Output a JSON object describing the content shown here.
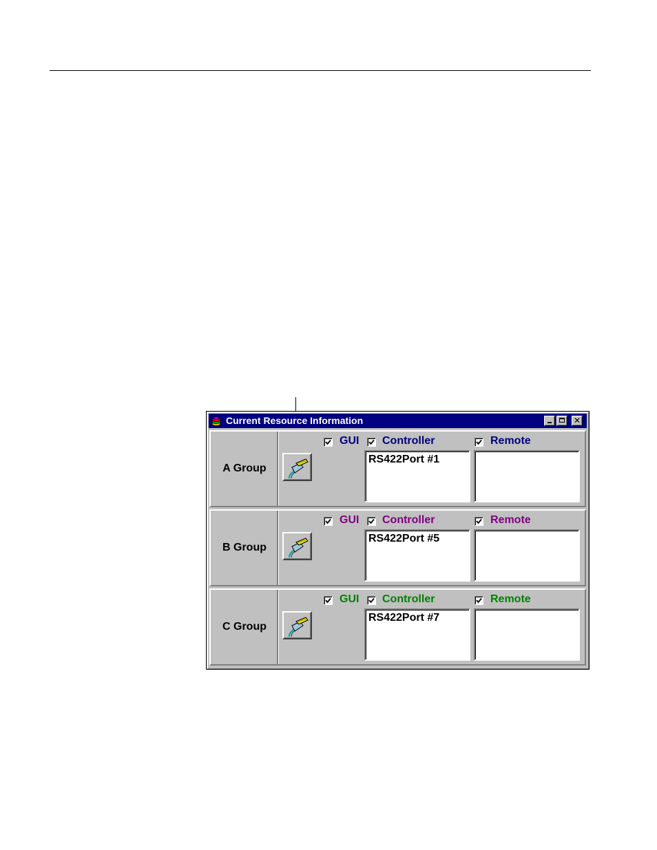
{
  "window": {
    "title": "Current Resource Information",
    "controls": [
      "minimize-icon",
      "maximize-icon",
      "close-icon"
    ]
  },
  "groups": [
    {
      "label": "A Group",
      "color": "#000080",
      "gui_label": "GUI",
      "gui_checked": true,
      "controller_label": "Controller",
      "controller_checked": true,
      "remote_label": "Remote",
      "remote_checked": true,
      "controller_items": [
        "RS422Port #1"
      ],
      "remote_items": []
    },
    {
      "label": "B Group",
      "color": "#800080",
      "gui_label": "GUI",
      "gui_checked": true,
      "controller_label": "Controller",
      "controller_checked": true,
      "remote_label": "Remote",
      "remote_checked": true,
      "controller_items": [
        "RS422Port #5"
      ],
      "remote_items": []
    },
    {
      "label": "C Group",
      "color": "#008000",
      "gui_label": "GUI",
      "gui_checked": true,
      "controller_label": "Controller",
      "controller_checked": true,
      "remote_label": "Remote",
      "remote_checked": true,
      "controller_items": [
        "RS422Port #7"
      ],
      "remote_items": []
    }
  ],
  "icons": {
    "app": "resource-app-icon",
    "port_button": "port-connector-icon",
    "check": "checkmark-icon"
  }
}
